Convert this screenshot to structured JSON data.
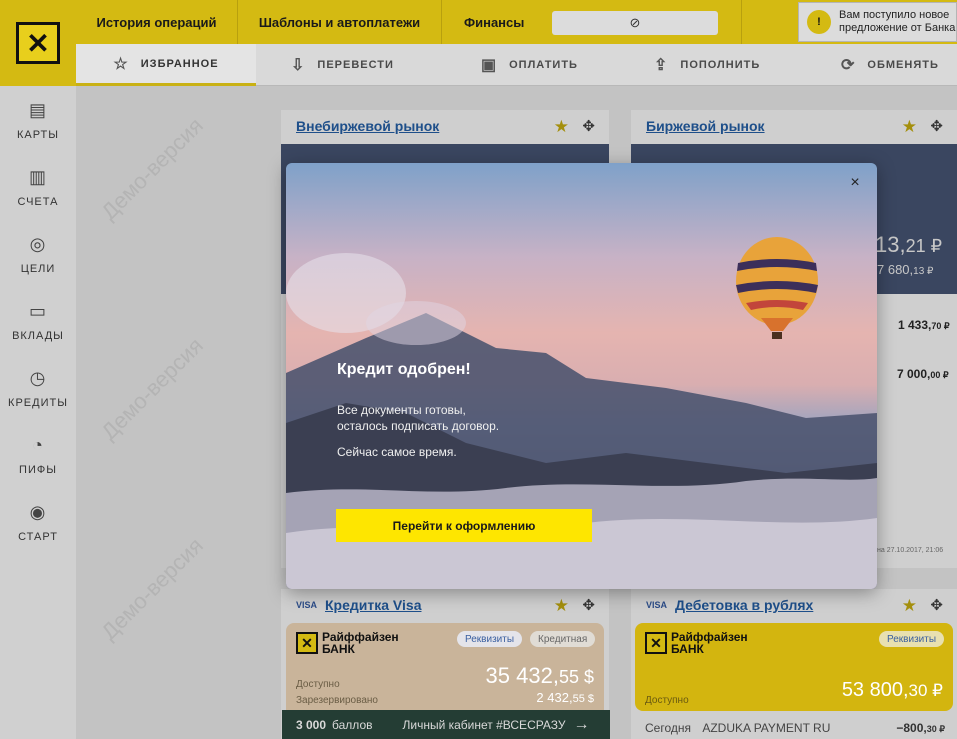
{
  "header": {
    "nav": [
      "История операций",
      "Шаблоны и автоплатежи",
      "Финансы"
    ],
    "eye_icon": "eye-slash-icon",
    "offer": {
      "line1": "Вам поступило новое",
      "line2": "предложение от Банка"
    }
  },
  "actions": [
    {
      "label": "ИЗБРАННОЕ",
      "icon": "star-outline-icon"
    },
    {
      "label": "ПЕРЕВЕСТИ",
      "icon": "transfer-icon"
    },
    {
      "label": "ОПЛАТИТЬ",
      "icon": "wallet-icon"
    },
    {
      "label": "ПОПОЛНИТЬ",
      "icon": "deposit-icon"
    },
    {
      "label": "ОБМЕНЯТЬ",
      "icon": "exchange-icon"
    }
  ],
  "sidebar": [
    {
      "label": "КАРТЫ",
      "icon": "cards-icon"
    },
    {
      "label": "СЧЕТА",
      "icon": "accounts-icon"
    },
    {
      "label": "ЦЕЛИ",
      "icon": "target-icon"
    },
    {
      "label": "ВКЛАДЫ",
      "icon": "deposit-box-icon"
    },
    {
      "label": "КРЕДИТЫ",
      "icon": "credit-icon"
    },
    {
      "label": "ПИФЫ",
      "icon": "funds-icon"
    },
    {
      "label": "СТАРТ",
      "icon": "start-icon"
    }
  ],
  "watermark": "Демо-версия",
  "widgets": {
    "otc": {
      "title": "Внебиржевой рынок"
    },
    "exchange": {
      "title": "Биржевой рынок",
      "amount_main": "13,",
      "amount_cents": "21 ₽",
      "amount_sub": "7 680,",
      "amount_sub_cents": "13 ₽",
      "row1": "1 433,",
      "row1_cents": "70 ₽",
      "row2": "7 000,",
      "row2_cents": "00 ₽",
      "date_note": "на 27.10.2017, 21:06"
    },
    "credit_card": {
      "brand": "VISA",
      "title": "Кредитка Visa",
      "bank_line1": "Райффайзен",
      "bank_line2": "БАНК",
      "pill1": "Реквизиты",
      "pill2": "Кредитная",
      "available_label": "Доступно",
      "available_amount": "35 432,",
      "available_cents": "55 $",
      "reserved_label": "Зарезервировано",
      "reserved_amount": "2 432,",
      "reserved_cents": "55 $"
    },
    "debit_card": {
      "brand": "VISA",
      "title": "Дебетовка в рублях",
      "bank_line1": "Райффайзен",
      "bank_line2": "БАНК",
      "pill1": "Реквизиты",
      "available_label": "Доступно",
      "available_amount": "53 800,",
      "available_cents": "30 ₽",
      "tx_date": "Сегодня",
      "tx_name": "AZDUKA PAYMENT RU",
      "tx_amount": "−800,",
      "tx_cents": "30 ₽"
    },
    "bonus": {
      "points": "3 000",
      "unit": "баллов",
      "text": "Личный кабинет #ВСЕСРАЗУ",
      "arrow": "→"
    }
  },
  "modal": {
    "close": "×",
    "title": "Кредит одобрен!",
    "line1": "Все документы готовы,",
    "line2": "осталось подписать договор.",
    "line3": "Сейчас самое время.",
    "button": "Перейти к оформлению"
  },
  "colors": {
    "brand_yellow": "#fee600",
    "link_blue": "#1e4f8a"
  }
}
